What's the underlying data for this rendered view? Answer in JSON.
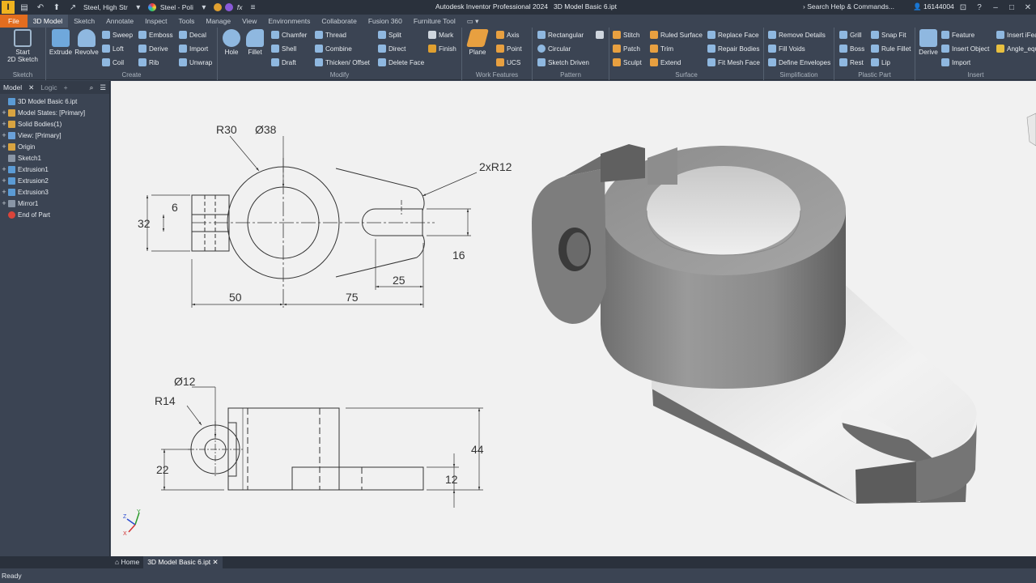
{
  "titlebar": {
    "logo": "I",
    "material": "Steel, High Str",
    "appearance": "Steel - Poli",
    "fx": "fx",
    "app_title": "Autodesk Inventor Professional 2024",
    "doc_title": "3D Model Basic 6.ipt",
    "search_placeholder": "Search Help & Commands...",
    "user": "16144004"
  },
  "tabs": [
    "File",
    "3D Model",
    "Sketch",
    "Annotate",
    "Inspect",
    "Tools",
    "Manage",
    "View",
    "Environments",
    "Collaborate",
    "Fusion 360",
    "Furniture Tool"
  ],
  "ribbon": {
    "sketch": {
      "label": "Sketch",
      "start": "Start",
      "start2": "2D Sketch"
    },
    "create": {
      "label": "Create",
      "extrude": "Extrude",
      "revolve": "Revolve",
      "sweep": "Sweep",
      "loft": "Loft",
      "coil": "Coil",
      "emboss": "Emboss",
      "derive": "Derive",
      "rib": "Rib",
      "decal": "Decal",
      "import": "Import",
      "unwrap": "Unwrap"
    },
    "modify": {
      "label": "Modify",
      "hole": "Hole",
      "fillet": "Fillet",
      "chamfer": "Chamfer",
      "shell": "Shell",
      "draft": "Draft",
      "thread": "Thread",
      "combine": "Combine",
      "thicken": "Thicken/ Offset",
      "split": "Split",
      "direct": "Direct",
      "delete_face": "Delete Face"
    },
    "mark": {
      "mark": "Mark",
      "finish": "Finish"
    },
    "work": {
      "label": "Work Features",
      "plane": "Plane",
      "axis": "Axis",
      "point": "Point",
      "ucs": "UCS"
    },
    "pattern": {
      "label": "Pattern",
      "rectangular": "Rectangular",
      "circular": "Circular",
      "sketch_driven": "Sketch Driven"
    },
    "surface": {
      "label": "Surface",
      "stitch": "Stitch",
      "patch": "Patch",
      "sculpt": "Sculpt",
      "ruled": "Ruled Surface",
      "trim": "Trim",
      "extend": "Extend",
      "replace": "Replace Face",
      "repair": "Repair Bodies",
      "fitmesh": "Fit Mesh Face"
    },
    "simplification": {
      "label": "Simplification",
      "remove": "Remove Details",
      "fill": "Fill Voids",
      "define": "Define Envelopes"
    },
    "plastic": {
      "label": "Plastic Part",
      "grill": "Grill",
      "boss": "Boss",
      "rest": "Rest",
      "snapfit": "Snap Fit",
      "rulefillet": "Rule Fillet",
      "lip": "Lip"
    },
    "insert": {
      "label": "Insert",
      "derive": "Derive",
      "feature": "Feature",
      "insert_object": "Insert Object",
      "import": "Import",
      "insert_ifeature": "Insert iFea",
      "angle": "Angle_equ"
    }
  },
  "browser": {
    "tab_model": "Model",
    "tab_logic": "Logic",
    "items": [
      {
        "label": "3D Model Basic 6.ipt",
        "exp": "",
        "color": "#5b9bd5"
      },
      {
        "label": "Model States: [Primary]",
        "exp": "+",
        "color": "#d9a441"
      },
      {
        "label": "Solid Bodies(1)",
        "exp": "+",
        "color": "#d9a441"
      },
      {
        "label": "View: [Primary]",
        "exp": "+",
        "color": "#6aa0d8"
      },
      {
        "label": "Origin",
        "exp": "+",
        "color": "#d9a441"
      },
      {
        "label": "Sketch1",
        "exp": "",
        "color": "#8a96a6"
      },
      {
        "label": "Extrusion1",
        "exp": "+",
        "color": "#5b9bd5"
      },
      {
        "label": "Extrusion2",
        "exp": "+",
        "color": "#5b9bd5"
      },
      {
        "label": "Extrusion3",
        "exp": "+",
        "color": "#5b9bd5"
      },
      {
        "label": "Mirror1",
        "exp": "+",
        "color": "#8a96a6"
      },
      {
        "label": "End of Part",
        "exp": "",
        "color": "#d9443a"
      }
    ]
  },
  "drawing": {
    "top": {
      "r30": "R30",
      "d38": "Ø38",
      "r12": "2xR12",
      "d6": "6",
      "d32": "32",
      "d16": "16",
      "d25": "25",
      "d50": "50",
      "d75": "75"
    },
    "front": {
      "d12": "Ø12",
      "r14": "R14",
      "d22": "22",
      "d44": "44",
      "d12b": "12"
    }
  },
  "doc_tabs": {
    "home": "Home",
    "doc": "3D Model Basic 6.ipt"
  },
  "status": "Ready"
}
